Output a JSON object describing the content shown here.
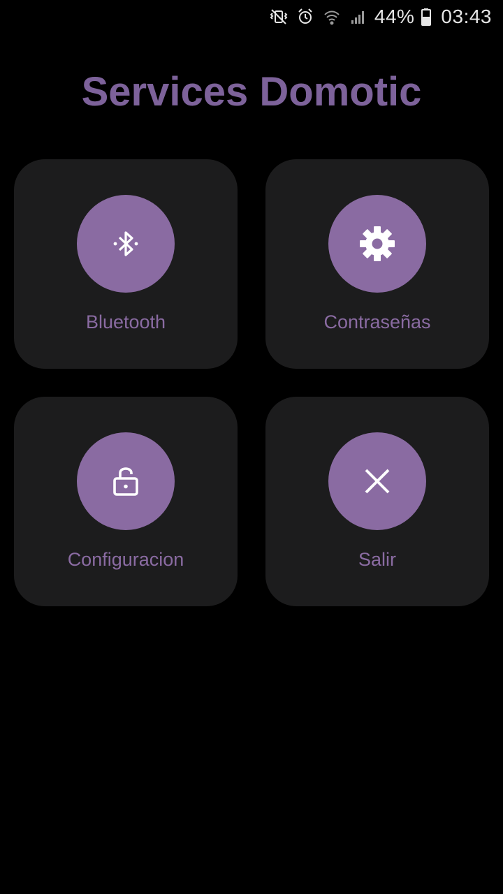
{
  "status_bar": {
    "icons": [
      "mute-vibrate-icon",
      "alarm-icon",
      "wifi-icon",
      "signal-icon",
      "battery-icon"
    ],
    "battery_percent": "44%",
    "time": "03:43"
  },
  "title": "Services Domotic",
  "colors": {
    "accent": "#8a6ba2",
    "title": "#7d629a",
    "card_bg": "#1c1c1d",
    "background": "#000000"
  },
  "cards": [
    {
      "label": "Bluetooth",
      "icon": "bluetooth-icon"
    },
    {
      "label": "Contraseñas",
      "icon": "gear-icon"
    },
    {
      "label": "Configuracion",
      "icon": "unlocked-padlock-icon"
    },
    {
      "label": "Salir",
      "icon": "close-icon"
    }
  ]
}
